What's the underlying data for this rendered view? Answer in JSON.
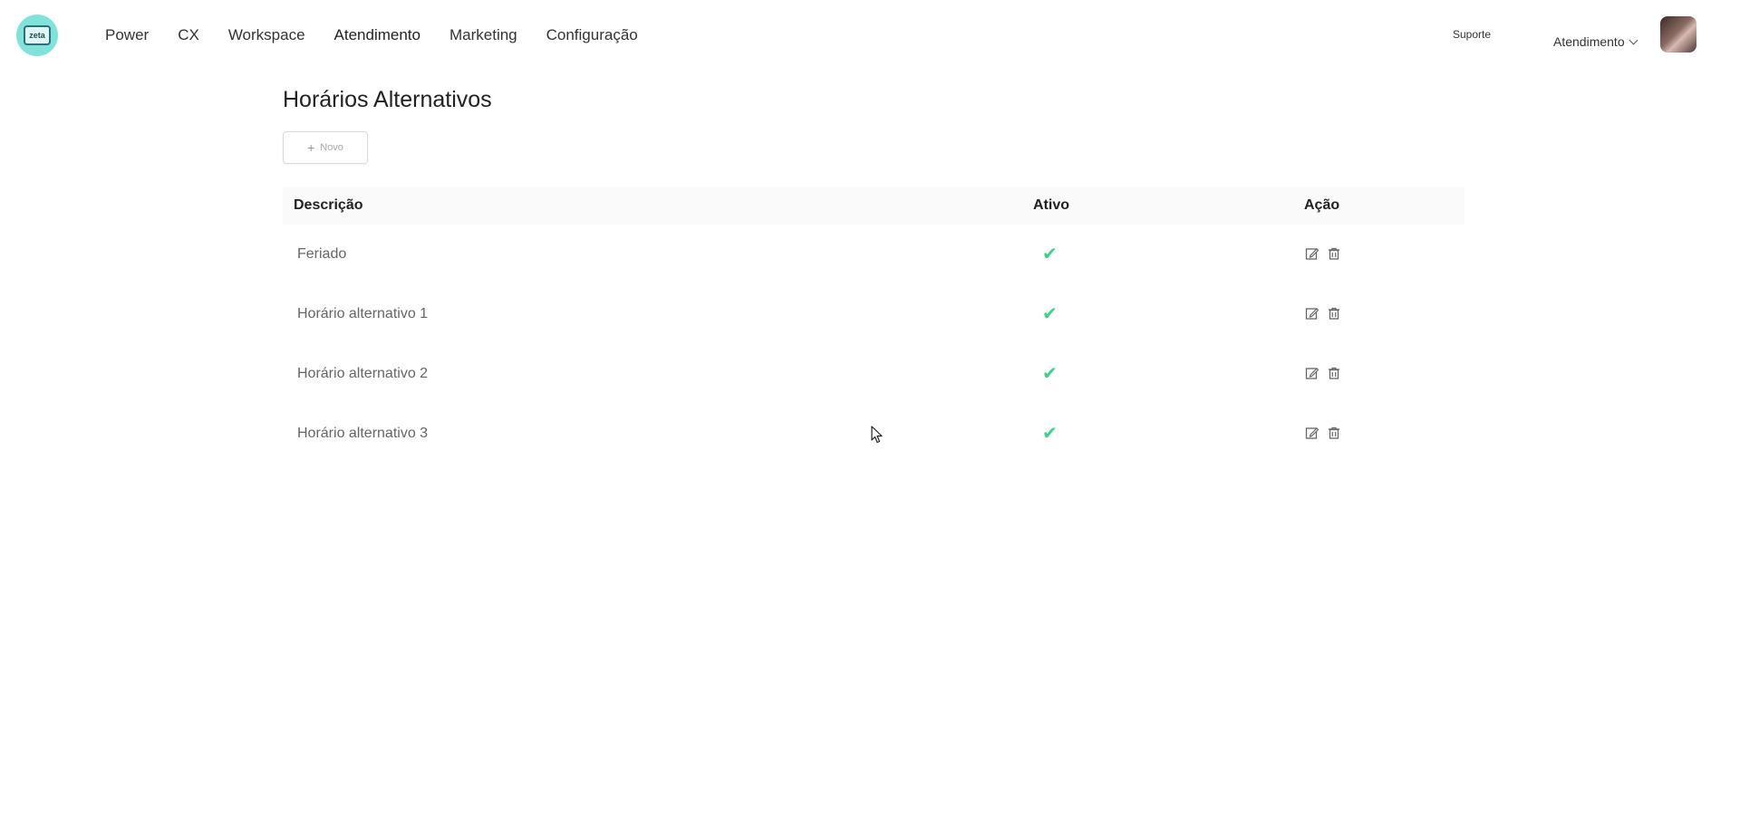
{
  "logo": {
    "text": "zeta"
  },
  "nav": {
    "items": [
      {
        "label": "Power"
      },
      {
        "label": "CX"
      },
      {
        "label": "Workspace"
      },
      {
        "label": "Atendimento"
      },
      {
        "label": "Marketing"
      },
      {
        "label": "Configuração"
      }
    ]
  },
  "header": {
    "support_label": "Suporte",
    "org_name": "Atendimento"
  },
  "page": {
    "title": "Horários Alternativos",
    "new_button_label": "Novo"
  },
  "table": {
    "columns": {
      "description": "Descrição",
      "active": "Ativo",
      "action": "Ação"
    },
    "rows": [
      {
        "description": "Feriado",
        "active": "✔"
      },
      {
        "description": "Horário alternativo 1",
        "active": "✔"
      },
      {
        "description": "Horário alternativo 2",
        "active": "✔"
      },
      {
        "description": "Horário alternativo 3",
        "active": "✔"
      }
    ]
  },
  "colors": {
    "accent_check": "#39d38a",
    "logo_bg": "#7fe3d9",
    "header_bg": "#fafafa"
  },
  "icons": [
    "edit-icon",
    "trash-icon",
    "plus-icon",
    "chevron-down-icon",
    "check-icon",
    "mouse-cursor"
  ]
}
